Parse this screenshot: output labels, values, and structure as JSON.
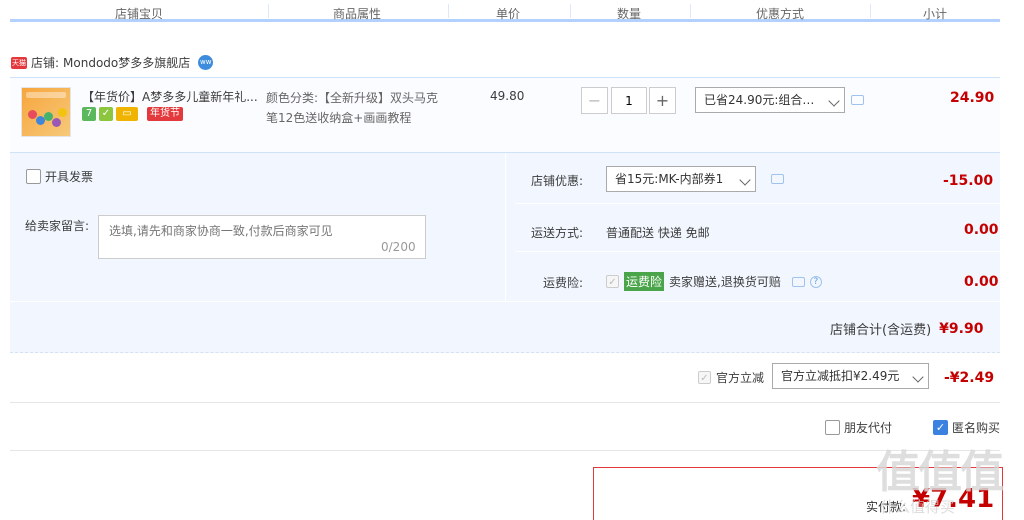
{
  "header": {
    "cols": [
      "店铺宝贝",
      "商品属性",
      "单价",
      "数量",
      "优惠方式",
      "小计"
    ]
  },
  "shop": {
    "label": "店铺:",
    "name": "Mondodo梦多多旗舰店",
    "tmall_badge": "天猫",
    "ww_badge": "ww"
  },
  "item": {
    "title": "【年货价】A梦多多儿童新年礼...",
    "badge_text": "年货节",
    "badge_seven": "7",
    "attr_line1": "颜色分类:【全新升级】双头马克",
    "attr_line2": "笔12色送收纳盒+画画教程",
    "unit_price": "49.80",
    "qty_minus": "−",
    "qty_plus": "+",
    "qty_value": "1",
    "promo_select": "已省24.90元:组合…",
    "subtotal": "24.90"
  },
  "invoice": {
    "label": "开具发票"
  },
  "message": {
    "label": "给卖家留言:",
    "placeholder": "选填,请先和商家协商一致,付款后商家可见",
    "counter": "0/200"
  },
  "shop_discount": {
    "label": "店铺优惠:",
    "select": "省15元:MK-内部券1",
    "amount": "-15.00"
  },
  "shipping": {
    "label": "运送方式:",
    "value": "普通配送 快递 免邮",
    "amount": "0.00"
  },
  "insurance": {
    "label": "运费险:",
    "tag": "运费险",
    "desc": "卖家赠送,退换货可赔",
    "hint": "?",
    "amount": "0.00"
  },
  "shop_total": {
    "label": "店铺合计(含运费)",
    "value": "¥9.90"
  },
  "official": {
    "label": "官方立减",
    "select": "官方立减抵扣¥2.49元",
    "amount": "-¥2.49"
  },
  "options": {
    "friend_pay": "朋友代付",
    "anonymous": "匿名购买"
  },
  "pay": {
    "label": "实付款:",
    "value": "¥7.41"
  },
  "watermark": {
    "text": "值值值",
    "sub": "什么值得买"
  },
  "colors": {
    "accent": "#c40000",
    "header_line": "#b2d1ff",
    "block_bg": "#f2f7ff",
    "checkbox": "#3b82e0"
  }
}
